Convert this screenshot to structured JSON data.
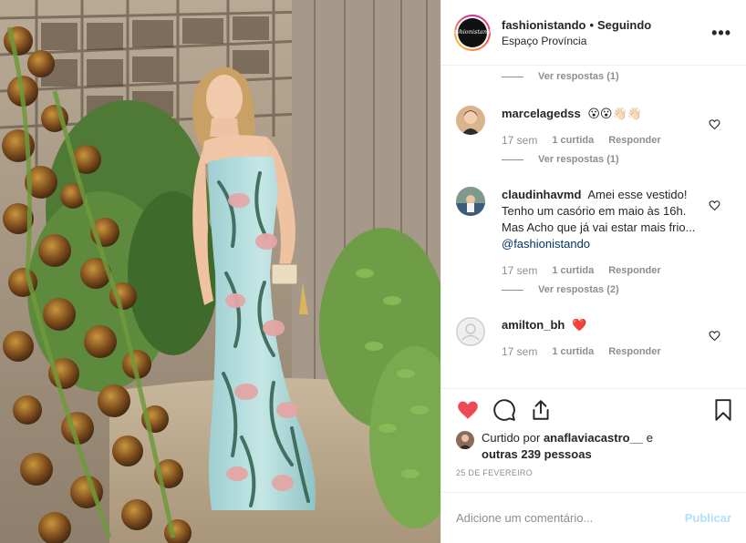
{
  "post": {
    "author": "fashionistando",
    "separator": "•",
    "follow_status": "Seguindo",
    "location": "Espaço Província",
    "avatar_text_lines": [
      "fashio",
      "nista",
      "ndo"
    ],
    "more_icon": "more-horizontal-icon"
  },
  "comments": [
    {
      "user": "marcelagedss",
      "text": "😮😮👋🏻👋🏻",
      "mention": "",
      "time": "17 sem",
      "likes": "1 curtida",
      "reply": "Responder",
      "view_replies": "Ver respostas (1)"
    },
    {
      "user": "claudinhavmd",
      "text": "Amei esse vestido! Tenho um casório em maio às 16h. Mas Acho que já vai estar mais frio...",
      "mention": "@fashionistando",
      "time": "17 sem",
      "likes": "1 curtida",
      "reply": "Responder",
      "view_replies": "Ver respostas (2)"
    },
    {
      "user": "amilton_bh",
      "text": "❤️",
      "mention": "",
      "time": "17 sem",
      "likes": "1 curtida",
      "reply": "Responder",
      "view_replies": ""
    }
  ],
  "top_view_replies": "Ver respostas (1)",
  "actions": {
    "like_icon": "heart-filled-icon",
    "comment_icon": "comment-icon",
    "share_icon": "share-icon",
    "save_icon": "bookmark-icon",
    "liked": true,
    "like_color": "#ed4956"
  },
  "likes_summary": {
    "prefix": "Curtido por",
    "user": "anaflaviacastro__",
    "conjunction": "e",
    "others": "outras 239 pessoas"
  },
  "date": "25 DE FEVEREIRO",
  "add_comment": {
    "placeholder": "Adicione um comentário...",
    "publish_label": "Publicar"
  }
}
